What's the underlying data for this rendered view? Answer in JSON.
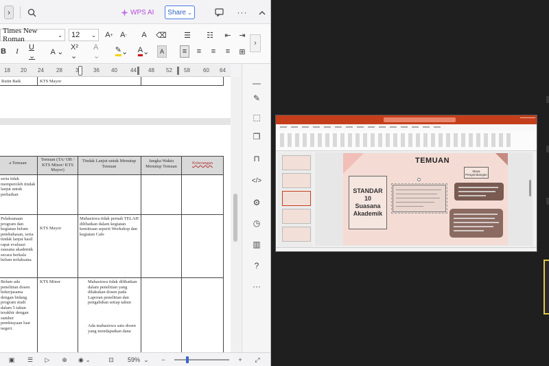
{
  "wps": {
    "toolbar": {
      "wps_ai_label": "WPS AI",
      "share_label": "Share"
    },
    "format": {
      "font_name": "Times New Roman",
      "font_size": "12"
    },
    "ruler": [
      "18",
      "20",
      "24",
      "28",
      "32",
      "36",
      "40",
      "44",
      "48",
      "52",
      "58",
      "60",
      "64"
    ],
    "table": {
      "headers": [
        "a Temuan",
        "Temuan (TA/ OB / KTS Minor/ KTS Mayor)",
        "Tindak Lanjut untuk Menutup Temuan",
        "Jangka Waktu Menutup Temuan",
        "Keterangan"
      ],
      "page1_cells": [
        "Rutin Baik",
        "KTS Mayor"
      ],
      "row1_col1": "serta tidak memperoleh tindak lanjut untuk perbaikan",
      "row2_col1": "Pelaksanaan program dan kegiatan belum pembahasan, serta tindak lanjut hasil rapat evaluasi suasana akademik secara berkala belum terlaksana.",
      "row2_col2": "KTS Mayor",
      "row2_col3": "Mahasiswa tidak pernah TELAH dilibatkan dalam kegiatan kemitraan seperti Workshop dan kegiatan Cafe",
      "row3_col1": "Belum ada penelitian dosen bekerjasama dengan bidang program studi dalam 5 tahun terakhir dengan sumber pembiayaan luar negeri.",
      "row3_col2": "KTS Minor",
      "row3_col3a": "Mahasiswa tidak dilibatkan dalam penelitian yang dilakukan dosen pada Laporan penelitian dan pengabdian setiap tahun",
      "row3_col3b": "Ada mahasiswa satu dosen yang mendapatkan dana"
    },
    "status": {
      "zoom": "59%"
    }
  },
  "slide": {
    "title": "TEMUAN",
    "box_lines": [
      "STANDAR",
      "10",
      "Suasana",
      "Akademik"
    ],
    "label_box": "Masa Pengembangan"
  },
  "colors": {
    "ppt_accent": "#c43e1c",
    "slide_bg": "#f4dcd4",
    "share_border": "#4a7be0",
    "wps_ai": "#b44bd6",
    "dark_bg": "#1f1f1f",
    "active_speaker": "#e3c94d"
  }
}
